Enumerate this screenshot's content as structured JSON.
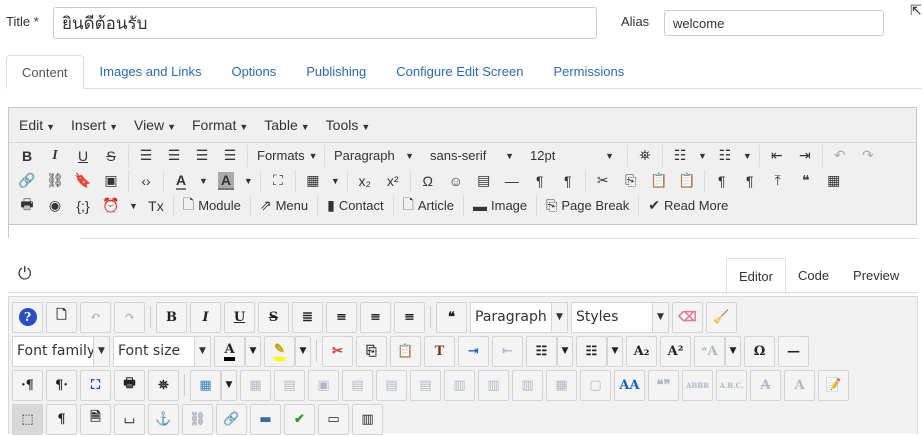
{
  "form": {
    "title_label": "Title *",
    "title_value": "ยินดีต้อนรับ",
    "alias_label": "Alias",
    "alias_value": "welcome"
  },
  "tabs": [
    {
      "label": "Content",
      "active": true
    },
    {
      "label": "Images and Links"
    },
    {
      "label": "Options"
    },
    {
      "label": "Publishing"
    },
    {
      "label": "Configure Edit Screen"
    },
    {
      "label": "Permissions"
    }
  ],
  "tinymce": {
    "menus": [
      "Edit",
      "Insert",
      "View",
      "Format",
      "Table",
      "Tools"
    ],
    "rows": [
      [
        {
          "k": "b",
          "icon": "bold-icon",
          "g": "B"
        },
        {
          "k": "b",
          "icon": "italic-icon",
          "g": "I"
        },
        {
          "k": "b",
          "icon": "underline-icon",
          "g": "U"
        },
        {
          "k": "b",
          "icon": "strikethrough-icon",
          "g": "S"
        },
        {
          "k": "sep"
        },
        {
          "k": "b",
          "icon": "align-left-icon",
          "g": "☰"
        },
        {
          "k": "b",
          "icon": "align-center-icon",
          "g": "☰"
        },
        {
          "k": "b",
          "icon": "align-right-icon",
          "g": "☰"
        },
        {
          "k": "b",
          "icon": "align-justify-icon",
          "g": "☰"
        },
        {
          "k": "sep"
        },
        {
          "k": "s",
          "label": "Formats",
          "w": 70,
          "compact": true
        },
        {
          "k": "sep"
        },
        {
          "k": "s",
          "label": "Paragraph",
          "w": 96
        },
        {
          "k": "s",
          "label": "sans-serif",
          "w": 100
        },
        {
          "k": "s",
          "label": "12pt",
          "w": 100
        },
        {
          "k": "sep"
        },
        {
          "k": "b",
          "icon": "find-icon",
          "g": "⛯"
        },
        {
          "k": "sep"
        },
        {
          "k": "b",
          "icon": "bullet-list-icon",
          "g": "☷",
          "split": true
        },
        {
          "k": "b",
          "icon": "numbered-list-icon",
          "g": "☷",
          "split": true
        },
        {
          "k": "sep"
        },
        {
          "k": "b",
          "icon": "outdent-icon",
          "g": "⇤"
        },
        {
          "k": "b",
          "icon": "indent-icon",
          "g": "⇥"
        },
        {
          "k": "sep"
        },
        {
          "k": "b",
          "icon": "undo-icon",
          "g": "↶",
          "dis": true
        },
        {
          "k": "b",
          "icon": "redo-icon",
          "g": "↷",
          "dis": true
        }
      ],
      [
        {
          "k": "b",
          "icon": "link-icon",
          "g": "🔗"
        },
        {
          "k": "b",
          "icon": "unlink-icon",
          "g": "⛓"
        },
        {
          "k": "b",
          "icon": "bookmark-icon",
          "g": "🔖"
        },
        {
          "k": "b",
          "icon": "image-icon",
          "g": "▣"
        },
        {
          "k": "sep"
        },
        {
          "k": "b",
          "icon": "code-icon",
          "g": "‹›"
        },
        {
          "k": "sep"
        },
        {
          "k": "b",
          "icon": "text-color-icon",
          "g": "A",
          "split": true
        },
        {
          "k": "b",
          "icon": "background-color-icon",
          "g": "A",
          "split": true
        },
        {
          "k": "sep"
        },
        {
          "k": "b",
          "icon": "fullscreen-icon",
          "g": "⛶"
        },
        {
          "k": "sep"
        },
        {
          "k": "b",
          "icon": "table-icon",
          "g": "▦",
          "split": true
        },
        {
          "k": "sep"
        },
        {
          "k": "b",
          "icon": "subscript-icon",
          "g": "x₂"
        },
        {
          "k": "b",
          "icon": "superscript-icon",
          "g": "x²"
        },
        {
          "k": "sep"
        },
        {
          "k": "b",
          "icon": "special-character-icon",
          "g": "Ω"
        },
        {
          "k": "b",
          "icon": "emoticons-icon",
          "g": "☺"
        },
        {
          "k": "b",
          "icon": "media-icon",
          "g": "▤"
        },
        {
          "k": "b",
          "icon": "horizontal-rule-icon",
          "g": "—"
        },
        {
          "k": "b",
          "icon": "ltr-icon",
          "g": "¶"
        },
        {
          "k": "b",
          "icon": "rtl-icon",
          "g": "¶"
        },
        {
          "k": "sep"
        },
        {
          "k": "b",
          "icon": "cut-icon",
          "g": "✂"
        },
        {
          "k": "b",
          "icon": "copy-icon",
          "g": "⎘"
        },
        {
          "k": "b",
          "icon": "paste-icon",
          "g": "📋"
        },
        {
          "k": "b",
          "icon": "paste-text-icon",
          "g": "📋"
        },
        {
          "k": "sep"
        },
        {
          "k": "b",
          "icon": "visual-chars-icon",
          "g": "¶"
        },
        {
          "k": "b",
          "icon": "visual-blocks-icon",
          "g": "¶"
        },
        {
          "k": "b",
          "icon": "upload-icon",
          "g": "⤒"
        },
        {
          "k": "b",
          "icon": "blockquote-icon",
          "g": "❝"
        },
        {
          "k": "b",
          "icon": "template-icon",
          "g": "▦"
        }
      ],
      [
        {
          "k": "b",
          "icon": "print-icon",
          "g": "🖶"
        },
        {
          "k": "b",
          "icon": "preview-icon",
          "g": "◉"
        },
        {
          "k": "b",
          "icon": "code-sample-icon",
          "g": "{;}"
        },
        {
          "k": "b",
          "icon": "date-time-icon",
          "g": "⏰",
          "split": true
        },
        {
          "k": "b",
          "icon": "clear-formatting-icon",
          "g": "Tx"
        },
        {
          "k": "sep"
        },
        {
          "k": "b",
          "icon": "module-icon",
          "g": "🗋",
          "t": "Module"
        },
        {
          "k": "sep"
        },
        {
          "k": "b",
          "icon": "menu-icon",
          "g": "⇗",
          "t": "Menu"
        },
        {
          "k": "sep"
        },
        {
          "k": "b",
          "icon": "contact-icon",
          "g": "▮",
          "t": "Contact"
        },
        {
          "k": "sep"
        },
        {
          "k": "b",
          "icon": "article-icon",
          "g": "🗋",
          "t": "Article"
        },
        {
          "k": "sep"
        },
        {
          "k": "b",
          "icon": "image-icon",
          "g": "▬",
          "t": "Image"
        },
        {
          "k": "sep"
        },
        {
          "k": "b",
          "icon": "page-break-icon",
          "g": "⎘",
          "t": "Page Break"
        },
        {
          "k": "sep"
        },
        {
          "k": "b",
          "icon": "read-more-icon",
          "g": "✔",
          "t": "Read More"
        }
      ]
    ]
  },
  "editor_tabs": [
    {
      "label": "Editor",
      "active": true
    },
    {
      "label": "Code"
    },
    {
      "label": "Preview"
    }
  ],
  "jce": {
    "rows": [
      [
        {
          "k": "b",
          "icon": "help-icon",
          "g": "?"
        },
        {
          "k": "b",
          "icon": "new-document-icon",
          "g": "🗋"
        },
        {
          "k": "b",
          "icon": "undo-icon",
          "g": "↶",
          "dis": true
        },
        {
          "k": "b",
          "icon": "redo-icon",
          "g": "↷",
          "dis": true
        },
        {
          "k": "sep"
        },
        {
          "k": "b",
          "icon": "bold-icon",
          "g": "B"
        },
        {
          "k": "b",
          "icon": "italic-icon",
          "g": "I"
        },
        {
          "k": "b",
          "icon": "underline-icon",
          "g": "U"
        },
        {
          "k": "b",
          "icon": "strikethrough-icon",
          "g": "S"
        },
        {
          "k": "b",
          "icon": "align-justify-icon",
          "g": "≣"
        },
        {
          "k": "b",
          "icon": "align-center-icon",
          "g": "≡"
        },
        {
          "k": "b",
          "icon": "align-left-icon",
          "g": "≡"
        },
        {
          "k": "b",
          "icon": "align-right-icon",
          "g": "≡"
        },
        {
          "k": "sep"
        },
        {
          "k": "b",
          "icon": "blockquote-icon",
          "g": "❝"
        },
        {
          "k": "s",
          "label": "Paragraph",
          "w": 98
        },
        {
          "k": "s",
          "label": "Styles",
          "w": 98
        },
        {
          "k": "b",
          "icon": "eraser-icon",
          "g": "⌫"
        },
        {
          "k": "b",
          "icon": "cleanup-icon",
          "g": "🧹"
        }
      ],
      [
        {
          "k": "s",
          "label": "Font family",
          "w": 98
        },
        {
          "k": "s",
          "label": "Font size",
          "w": 98
        },
        {
          "k": "b",
          "icon": "font-color-icon",
          "g": "A",
          "split": true
        },
        {
          "k": "b",
          "icon": "highlight-icon",
          "g": "✎",
          "split": true
        },
        {
          "k": "sep"
        },
        {
          "k": "b",
          "icon": "cut-icon",
          "g": "✂"
        },
        {
          "k": "b",
          "icon": "copy-icon",
          "g": "⎘"
        },
        {
          "k": "b",
          "icon": "paste-icon",
          "g": "📋"
        },
        {
          "k": "b",
          "icon": "paste-text-icon",
          "g": "T"
        },
        {
          "k": "b",
          "icon": "indent-icon",
          "g": "⇥"
        },
        {
          "k": "b",
          "icon": "outdent-icon",
          "g": "⇤",
          "dis": true
        },
        {
          "k": "b",
          "icon": "numbered-list-icon",
          "g": "☷",
          "split": true
        },
        {
          "k": "b",
          "icon": "bullet-list-icon",
          "g": "☷",
          "split": true
        },
        {
          "k": "b",
          "icon": "subscript-icon",
          "g": "A₂"
        },
        {
          "k": "b",
          "icon": "superscript-icon",
          "g": "A²"
        },
        {
          "k": "b",
          "icon": "change-case-icon",
          "g": "ᵃA",
          "dis": true,
          "split": true
        },
        {
          "k": "b",
          "icon": "special-character-icon",
          "g": "Ω"
        },
        {
          "k": "b",
          "icon": "horizontal-rule-icon",
          "g": "—"
        }
      ],
      [
        {
          "k": "b",
          "icon": "ltr-icon",
          "g": "·¶"
        },
        {
          "k": "b",
          "icon": "rtl-icon",
          "g": "¶·"
        },
        {
          "k": "b",
          "icon": "fullscreen-icon",
          "g": "⛶"
        },
        {
          "k": "b",
          "icon": "print-icon",
          "g": "🖶"
        },
        {
          "k": "b",
          "icon": "find-icon",
          "g": "⛯"
        },
        {
          "k": "sep"
        },
        {
          "k": "b",
          "icon": "table-icon",
          "g": "▦",
          "split": true
        },
        {
          "k": "b",
          "icon": "delete-table-icon",
          "g": "▦",
          "dis": true
        },
        {
          "k": "b",
          "icon": "row-props-icon",
          "g": "▤",
          "dis": true
        },
        {
          "k": "b",
          "icon": "cell-props-icon",
          "g": "▣",
          "dis": true
        },
        {
          "k": "b",
          "icon": "insert-row-before-icon",
          "g": "▤",
          "dis": true
        },
        {
          "k": "b",
          "icon": "insert-row-after-icon",
          "g": "▤",
          "dis": true
        },
        {
          "k": "b",
          "icon": "delete-row-icon",
          "g": "▤",
          "dis": true
        },
        {
          "k": "b",
          "icon": "insert-col-before-icon",
          "g": "▥",
          "dis": true
        },
        {
          "k": "b",
          "icon": "insert-col-after-icon",
          "g": "▥",
          "dis": true
        },
        {
          "k": "b",
          "icon": "delete-col-icon",
          "g": "▥",
          "dis": true
        },
        {
          "k": "b",
          "icon": "split-cells-icon",
          "g": "▦",
          "dis": true
        },
        {
          "k": "b",
          "icon": "merge-cells-icon",
          "g": "▢",
          "dis": true
        },
        {
          "k": "b",
          "icon": "style-icon",
          "g": "AA"
        },
        {
          "k": "b",
          "icon": "cite-icon",
          "g": "❝❞",
          "dis": true
        },
        {
          "k": "b",
          "icon": "abbr-icon",
          "g": "ABBR",
          "dis": true
        },
        {
          "k": "b",
          "icon": "acronym-icon",
          "g": "A.B.C.",
          "dis": true
        },
        {
          "k": "b",
          "icon": "del-icon",
          "g": "A",
          "dis": true
        },
        {
          "k": "b",
          "icon": "ins-icon",
          "g": "A",
          "dis": true
        },
        {
          "k": "b",
          "icon": "attributes-icon",
          "g": "📝"
        }
      ],
      [
        {
          "k": "b",
          "icon": "visual-aid-icon",
          "g": "⬚",
          "act": true
        },
        {
          "k": "b",
          "icon": "visual-chars-icon",
          "g": "¶"
        },
        {
          "k": "b",
          "icon": "source-icon",
          "g": "🗎"
        },
        {
          "k": "b",
          "icon": "non-breaking-icon",
          "g": "⌴"
        },
        {
          "k": "b",
          "icon": "anchor-icon",
          "g": "⚓"
        },
        {
          "k": "b",
          "icon": "unlink-icon",
          "g": "⛓",
          "dis": true
        },
        {
          "k": "b",
          "icon": "link-icon",
          "g": "🔗"
        },
        {
          "k": "b",
          "icon": "image-icon",
          "g": "▬"
        },
        {
          "k": "b",
          "icon": "spellcheck-icon",
          "g": "✔"
        },
        {
          "k": "b",
          "icon": "article-break-icon",
          "g": "▭"
        },
        {
          "k": "b",
          "icon": "template-icon",
          "g": "▥"
        }
      ]
    ]
  },
  "colors": {
    "link": "#2a69b8",
    "border": "#dddddd",
    "toolbar_bg": "#f0f0f0"
  }
}
